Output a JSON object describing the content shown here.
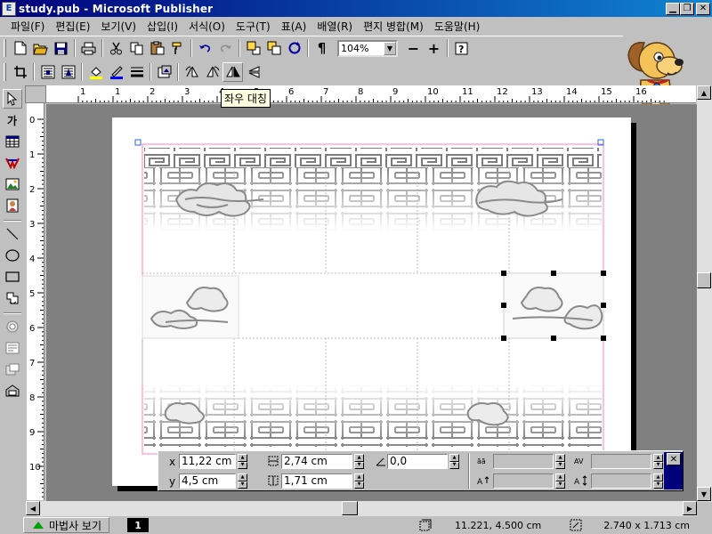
{
  "window": {
    "title": "study.pub - Microsoft Publisher",
    "app_icon_letter": "E"
  },
  "menu": [
    {
      "label": "파일(F)"
    },
    {
      "label": "편집(E)"
    },
    {
      "label": "보기(V)"
    },
    {
      "label": "삽입(I)"
    },
    {
      "label": "서식(O)"
    },
    {
      "label": "도구(T)"
    },
    {
      "label": "표(A)"
    },
    {
      "label": "배열(R)"
    },
    {
      "label": "편지 병합(M)"
    },
    {
      "label": "도움말(H)"
    }
  ],
  "toolbar": {
    "zoom": "104%"
  },
  "tooltip": "좌우 대칭",
  "rulers": {
    "h_labels": [
      "1",
      "1",
      "2",
      "3",
      "4",
      "5",
      "6",
      "7",
      "8",
      "9",
      "10",
      "11",
      "12",
      "13",
      "14",
      "15",
      "16"
    ],
    "v_labels": [
      "0",
      "1",
      "2",
      "3",
      "4",
      "5",
      "6",
      "7",
      "8",
      "9",
      "10"
    ]
  },
  "measure": {
    "x_label": "x",
    "y_label": "y",
    "x_value": "11,22 cm",
    "y_value": "4,5 cm",
    "width_value": "2,74 cm",
    "height_value": "1,71 cm",
    "angle_value": "0,0"
  },
  "statusbar": {
    "wizard_label": "마법사 보기",
    "page_number": "1",
    "position": "11.221, 4.500 cm",
    "size": "2.740 x 1.713 cm"
  },
  "colors": {
    "titlebar_start": "#00007b",
    "titlebar_end": "#1084d0",
    "workspace": "#808080",
    "chrome": "#c0c0c0"
  }
}
